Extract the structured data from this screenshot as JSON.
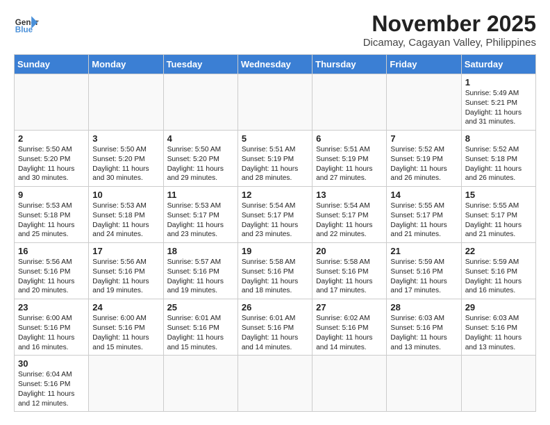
{
  "header": {
    "logo_general": "General",
    "logo_blue": "Blue",
    "month_title": "November 2025",
    "location": "Dicamay, Cagayan Valley, Philippines"
  },
  "days_of_week": [
    "Sunday",
    "Monday",
    "Tuesday",
    "Wednesday",
    "Thursday",
    "Friday",
    "Saturday"
  ],
  "weeks": [
    [
      {
        "day": "",
        "info": ""
      },
      {
        "day": "",
        "info": ""
      },
      {
        "day": "",
        "info": ""
      },
      {
        "day": "",
        "info": ""
      },
      {
        "day": "",
        "info": ""
      },
      {
        "day": "",
        "info": ""
      },
      {
        "day": "1",
        "info": "Sunrise: 5:49 AM\nSunset: 5:21 PM\nDaylight: 11 hours\nand 31 minutes."
      }
    ],
    [
      {
        "day": "2",
        "info": "Sunrise: 5:50 AM\nSunset: 5:20 PM\nDaylight: 11 hours\nand 30 minutes."
      },
      {
        "day": "3",
        "info": "Sunrise: 5:50 AM\nSunset: 5:20 PM\nDaylight: 11 hours\nand 30 minutes."
      },
      {
        "day": "4",
        "info": "Sunrise: 5:50 AM\nSunset: 5:20 PM\nDaylight: 11 hours\nand 29 minutes."
      },
      {
        "day": "5",
        "info": "Sunrise: 5:51 AM\nSunset: 5:19 PM\nDaylight: 11 hours\nand 28 minutes."
      },
      {
        "day": "6",
        "info": "Sunrise: 5:51 AM\nSunset: 5:19 PM\nDaylight: 11 hours\nand 27 minutes."
      },
      {
        "day": "7",
        "info": "Sunrise: 5:52 AM\nSunset: 5:19 PM\nDaylight: 11 hours\nand 26 minutes."
      },
      {
        "day": "8",
        "info": "Sunrise: 5:52 AM\nSunset: 5:18 PM\nDaylight: 11 hours\nand 26 minutes."
      }
    ],
    [
      {
        "day": "9",
        "info": "Sunrise: 5:53 AM\nSunset: 5:18 PM\nDaylight: 11 hours\nand 25 minutes."
      },
      {
        "day": "10",
        "info": "Sunrise: 5:53 AM\nSunset: 5:18 PM\nDaylight: 11 hours\nand 24 minutes."
      },
      {
        "day": "11",
        "info": "Sunrise: 5:53 AM\nSunset: 5:17 PM\nDaylight: 11 hours\nand 23 minutes."
      },
      {
        "day": "12",
        "info": "Sunrise: 5:54 AM\nSunset: 5:17 PM\nDaylight: 11 hours\nand 23 minutes."
      },
      {
        "day": "13",
        "info": "Sunrise: 5:54 AM\nSunset: 5:17 PM\nDaylight: 11 hours\nand 22 minutes."
      },
      {
        "day": "14",
        "info": "Sunrise: 5:55 AM\nSunset: 5:17 PM\nDaylight: 11 hours\nand 21 minutes."
      },
      {
        "day": "15",
        "info": "Sunrise: 5:55 AM\nSunset: 5:17 PM\nDaylight: 11 hours\nand 21 minutes."
      }
    ],
    [
      {
        "day": "16",
        "info": "Sunrise: 5:56 AM\nSunset: 5:16 PM\nDaylight: 11 hours\nand 20 minutes."
      },
      {
        "day": "17",
        "info": "Sunrise: 5:56 AM\nSunset: 5:16 PM\nDaylight: 11 hours\nand 19 minutes."
      },
      {
        "day": "18",
        "info": "Sunrise: 5:57 AM\nSunset: 5:16 PM\nDaylight: 11 hours\nand 19 minutes."
      },
      {
        "day": "19",
        "info": "Sunrise: 5:58 AM\nSunset: 5:16 PM\nDaylight: 11 hours\nand 18 minutes."
      },
      {
        "day": "20",
        "info": "Sunrise: 5:58 AM\nSunset: 5:16 PM\nDaylight: 11 hours\nand 17 minutes."
      },
      {
        "day": "21",
        "info": "Sunrise: 5:59 AM\nSunset: 5:16 PM\nDaylight: 11 hours\nand 17 minutes."
      },
      {
        "day": "22",
        "info": "Sunrise: 5:59 AM\nSunset: 5:16 PM\nDaylight: 11 hours\nand 16 minutes."
      }
    ],
    [
      {
        "day": "23",
        "info": "Sunrise: 6:00 AM\nSunset: 5:16 PM\nDaylight: 11 hours\nand 16 minutes."
      },
      {
        "day": "24",
        "info": "Sunrise: 6:00 AM\nSunset: 5:16 PM\nDaylight: 11 hours\nand 15 minutes."
      },
      {
        "day": "25",
        "info": "Sunrise: 6:01 AM\nSunset: 5:16 PM\nDaylight: 11 hours\nand 15 minutes."
      },
      {
        "day": "26",
        "info": "Sunrise: 6:01 AM\nSunset: 5:16 PM\nDaylight: 11 hours\nand 14 minutes."
      },
      {
        "day": "27",
        "info": "Sunrise: 6:02 AM\nSunset: 5:16 PM\nDaylight: 11 hours\nand 14 minutes."
      },
      {
        "day": "28",
        "info": "Sunrise: 6:03 AM\nSunset: 5:16 PM\nDaylight: 11 hours\nand 13 minutes."
      },
      {
        "day": "29",
        "info": "Sunrise: 6:03 AM\nSunset: 5:16 PM\nDaylight: 11 hours\nand 13 minutes."
      }
    ],
    [
      {
        "day": "30",
        "info": "Sunrise: 6:04 AM\nSunset: 5:16 PM\nDaylight: 11 hours\nand 12 minutes."
      },
      {
        "day": "",
        "info": ""
      },
      {
        "day": "",
        "info": ""
      },
      {
        "day": "",
        "info": ""
      },
      {
        "day": "",
        "info": ""
      },
      {
        "day": "",
        "info": ""
      },
      {
        "day": "",
        "info": ""
      }
    ]
  ]
}
